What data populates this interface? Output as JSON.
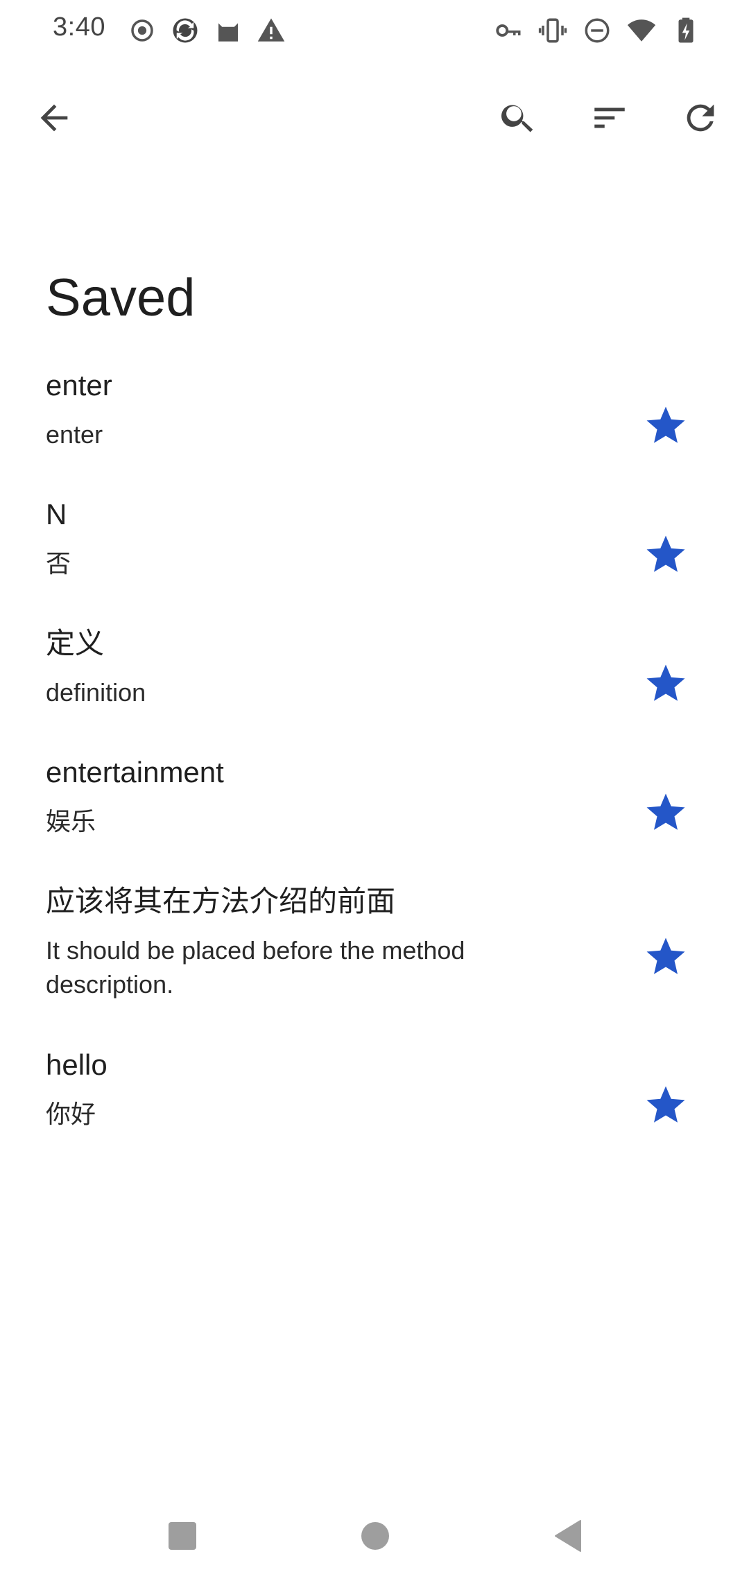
{
  "status_bar": {
    "time": "3:40",
    "left_icons": [
      "record-icon",
      "sync-app-icon",
      "cat-app-icon",
      "warning-icon"
    ],
    "right_icons": [
      "vpn-key-icon",
      "vibrate-icon",
      "do-not-disturb-icon",
      "wifi-icon",
      "battery-charging-icon"
    ]
  },
  "toolbar": {
    "back_icon": "arrow-back-icon",
    "search_icon": "search-icon",
    "sort_icon": "sort-icon",
    "refresh_icon": "refresh-icon"
  },
  "page": {
    "title": "Saved"
  },
  "saved_items": [
    {
      "source": "enter",
      "translation": "enter",
      "starred": true
    },
    {
      "source": "N",
      "translation": "否",
      "starred": true
    },
    {
      "source": "定义",
      "translation": "definition",
      "starred": true
    },
    {
      "source": "entertainment",
      "translation": "娱乐",
      "starred": true
    },
    {
      "source": "应该将其在方法介绍的前面",
      "translation": "It should be placed before the method description.",
      "starred": true
    },
    {
      "source": "hello",
      "translation": "你好",
      "starred": true
    }
  ],
  "colors": {
    "star": "#2456c8",
    "icon": "#444444",
    "text": "#1f1f1f",
    "nav": "#9e9e9e"
  },
  "nav_bar": {
    "icons": [
      "recents-icon",
      "home-icon",
      "back-icon"
    ]
  }
}
